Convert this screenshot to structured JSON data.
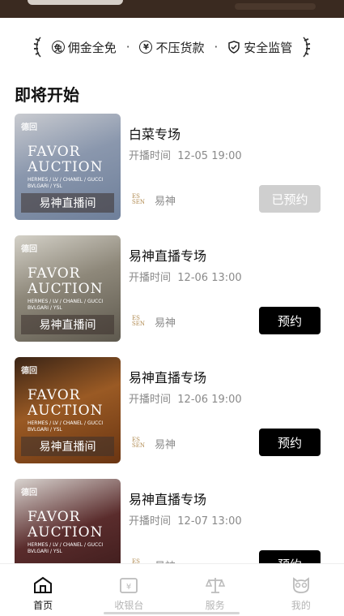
{
  "guarantees": [
    {
      "icon": "free-icon",
      "glyph": "免",
      "label": "佣金全免"
    },
    {
      "icon": "yen-icon",
      "glyph": "¥",
      "label": "不压货款"
    },
    {
      "icon": "shield-check-icon",
      "glyph": "",
      "label": "安全监管"
    }
  ],
  "section_title": "即将开始",
  "card_common": {
    "brand_mark": "德回",
    "favor_line1": "FAVOR",
    "favor_line2": "AUCTION",
    "brands_line1": "HERMES / LV / CHANEL / GUCCI",
    "brands_line2": "BVLGARI / YSL",
    "live_label": "易神直播间",
    "host_logo": "ES SEN",
    "host_name": "易神"
  },
  "auctions": [
    {
      "title": "白菜专场",
      "time_label": "开播时间",
      "time": "12-05 19:00",
      "button": "已预约",
      "reserved": true,
      "thumb_color": "#7d8aa0"
    },
    {
      "title": "易神直播专场",
      "time_label": "开播时间",
      "time": "12-06 13:00",
      "button": "预约",
      "reserved": false,
      "thumb_color": "#6e685c"
    },
    {
      "title": "易神直播专场",
      "time_label": "开播时间",
      "time": "12-06 19:00",
      "button": "预约",
      "reserved": false,
      "thumb_color": "#8a4a1e"
    },
    {
      "title": "易神直播专场",
      "time_label": "开播时间",
      "time": "12-07 13:00",
      "button": "预约",
      "reserved": false,
      "thumb_color": "#6b3838"
    }
  ],
  "nav": [
    {
      "label": "首页",
      "icon": "home-icon",
      "active": true
    },
    {
      "label": "收银台",
      "icon": "cashier-icon",
      "active": false
    },
    {
      "label": "服务",
      "icon": "scale-icon",
      "active": false
    },
    {
      "label": "我的",
      "icon": "owl-icon",
      "active": false
    }
  ],
  "colors": {
    "accent": "#000000",
    "reserved_button": "#cfcfcf",
    "muted_text": "#8a8a8a",
    "banner": "#3a2a20"
  }
}
